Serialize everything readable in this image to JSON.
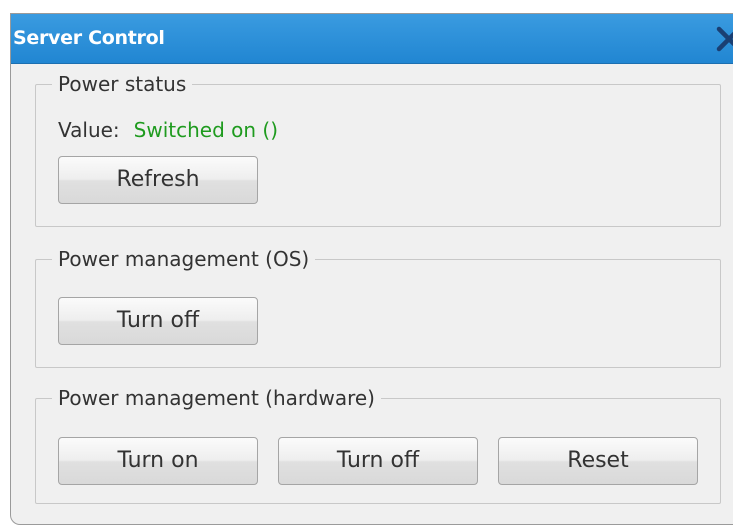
{
  "window": {
    "title": "Server Control"
  },
  "power_status": {
    "legend": "Power status",
    "value_label": "Value:",
    "value": "Switched on ()",
    "value_color": "#1f9b1f",
    "refresh_label": "Refresh"
  },
  "power_management_os": {
    "legend": "Power management (OS)",
    "turn_off_label": "Turn off"
  },
  "power_management_hardware": {
    "legend": "Power management (hardware)",
    "turn_on_label": "Turn on",
    "turn_off_label": "Turn off",
    "reset_label": "Reset"
  },
  "icons": {
    "close": "close-icon"
  },
  "colors": {
    "titlebar": "#2186d2",
    "background": "#f0f0f0"
  }
}
